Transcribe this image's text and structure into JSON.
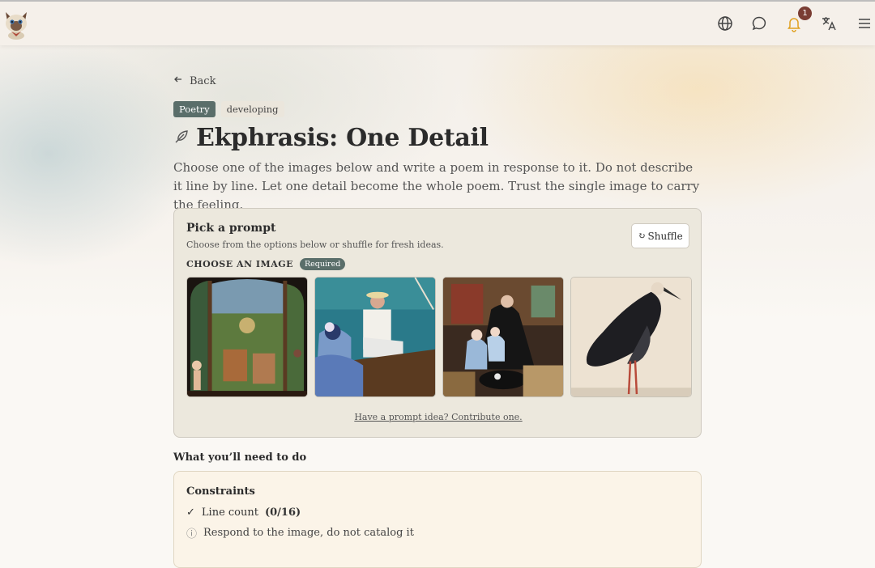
{
  "nav": {
    "notifications_count": "1"
  },
  "back_label": "Back",
  "tags": [
    "Poetry",
    "developing"
  ],
  "title": "Ekphrasis: One Detail",
  "description": "Choose one of the images below and write a poem in response to it. Do not describe it line by line. Let one detail become the whole poem. Trust the single image to carry the feeling.",
  "prompt_card": {
    "title": "Pick a prompt",
    "subtitle": "Choose from the options below or shuffle for fresh ideas.",
    "shuffle_label": "Shuffle",
    "choose_label": "CHOOSE AN IMAGE",
    "required_label": "Required",
    "contribute_link": "Have a prompt idea? Contribute one."
  },
  "todo_heading": "What you’ll need to do",
  "constraints": {
    "title": "Constraints",
    "items": [
      {
        "icon": "check-icon",
        "label": "Line count",
        "count": "(0/16)"
      },
      {
        "icon": "info-icon",
        "label": "Respond to the image, do not catalog it"
      }
    ]
  },
  "colors": {
    "tag_primary": "#5a6e6a",
    "badge": "#7a3d33",
    "bell": "#e0a020"
  }
}
